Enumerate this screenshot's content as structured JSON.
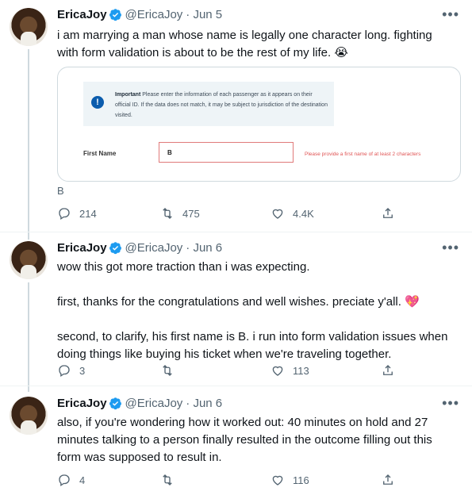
{
  "tweets": [
    {
      "name": "EricaJoy",
      "handle": "@EricaJoy",
      "date": "· Jun 5",
      "text_lines": [
        "i am marrying a man whose name is legally one character long. fighting with form validation is about to be the rest of my life. 😭"
      ],
      "alt_text": "B",
      "embed": {
        "notice_title": "Important",
        "notice_body": "Please enter the information of each passenger as it appears on their official ID. If the data does not match, it may be subject to jurisdiction of the destination visited.",
        "field_label": "First Name",
        "field_value": "B",
        "field_error": "Please provide a first name of at least 2 characters"
      },
      "replies": "214",
      "retweets": "475",
      "likes": "4.4K"
    },
    {
      "name": "EricaJoy",
      "handle": "@EricaJoy",
      "date": "· Jun 6",
      "text_paragraphs": [
        "wow this got more traction than i was expecting.",
        "first, thanks for the congratulations and well wishes. preciate y'all. 💖",
        "second, to clarify, his first name is B. i run into form validation issues when doing things like buying his ticket when we're traveling together."
      ],
      "replies": "3",
      "retweets": "",
      "likes": "113"
    },
    {
      "name": "EricaJoy",
      "handle": "@EricaJoy",
      "date": "· Jun 6",
      "text_paragraphs": [
        "also, if you're wondering how it worked out: 40 minutes on hold and 27 minutes talking to a person finally resulted in the outcome filling out this form was supposed to result in."
      ],
      "replies": "4",
      "retweets": "",
      "likes": "116"
    }
  ],
  "more_label": "•••",
  "colors": {
    "verified": "#1d9bf0",
    "icon": "#536471",
    "divider": "#eff3f4"
  }
}
